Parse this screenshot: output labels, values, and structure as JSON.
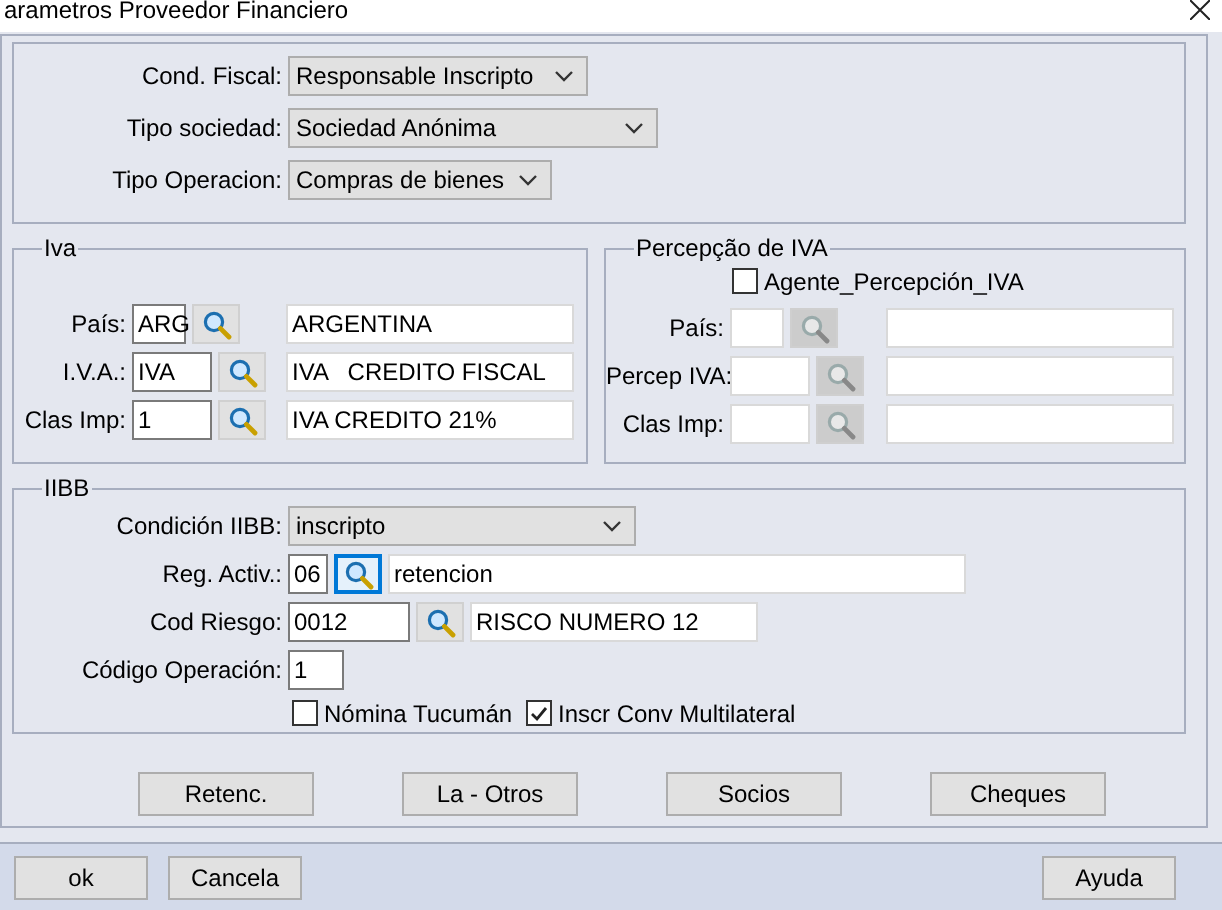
{
  "window": {
    "title": "arametros Proveedor Financiero"
  },
  "general": {
    "fields": [
      {
        "label": "Cond. Fiscal:",
        "value": "Responsable Inscripto"
      },
      {
        "label": "Tipo sociedad:",
        "value": "Sociedad Anónima"
      },
      {
        "label": "Tipo Operacion:",
        "value": "Compras de bienes"
      }
    ]
  },
  "iva": {
    "legend": "Iva",
    "rows": [
      {
        "label": "País:",
        "code": "ARG",
        "description": "ARGENTINA",
        "disabled": false
      },
      {
        "label": "I.V.A.:",
        "code": "IVA",
        "description": "IVA   CREDITO FISCAL",
        "disabled": false
      },
      {
        "label": "Clas Imp:",
        "code": "1",
        "description": "IVA CREDITO 21%",
        "disabled": false
      }
    ]
  },
  "percepcao": {
    "legend": "Percepção de IVA",
    "checkbox": {
      "label": "Agente_Percepción_IVA",
      "checked": false
    },
    "rows": [
      {
        "label": "País:",
        "disabled": true
      },
      {
        "label": "Percep IVA:",
        "disabled": true
      },
      {
        "label": "Clas Imp:",
        "disabled": true
      }
    ]
  },
  "iibb": {
    "legend": "IIBB",
    "condicion": {
      "label": "Condición IIBB:",
      "value": "inscripto"
    },
    "rows": [
      {
        "kind": "lookup",
        "label": "Reg. Activ.:",
        "code": "06",
        "description": "retencion",
        "focused": true
      },
      {
        "kind": "lookup",
        "label": "Cod Riesgo:",
        "code": "0012",
        "description": "RISCO NUMERO 12",
        "focused": false
      },
      {
        "kind": "input",
        "label": "Código Operación:",
        "code": "1"
      }
    ],
    "checkboxes": [
      {
        "label": "Nómina Tucumán",
        "checked": false
      },
      {
        "label": "Inscr Conv Multilateral",
        "checked": true
      }
    ]
  },
  "actions": [
    "Retenc.",
    "La - Otros",
    "Socios",
    "Cheques"
  ],
  "footer": {
    "left": [
      "ok",
      "Cancela"
    ],
    "right": [
      "Ayuda"
    ]
  }
}
